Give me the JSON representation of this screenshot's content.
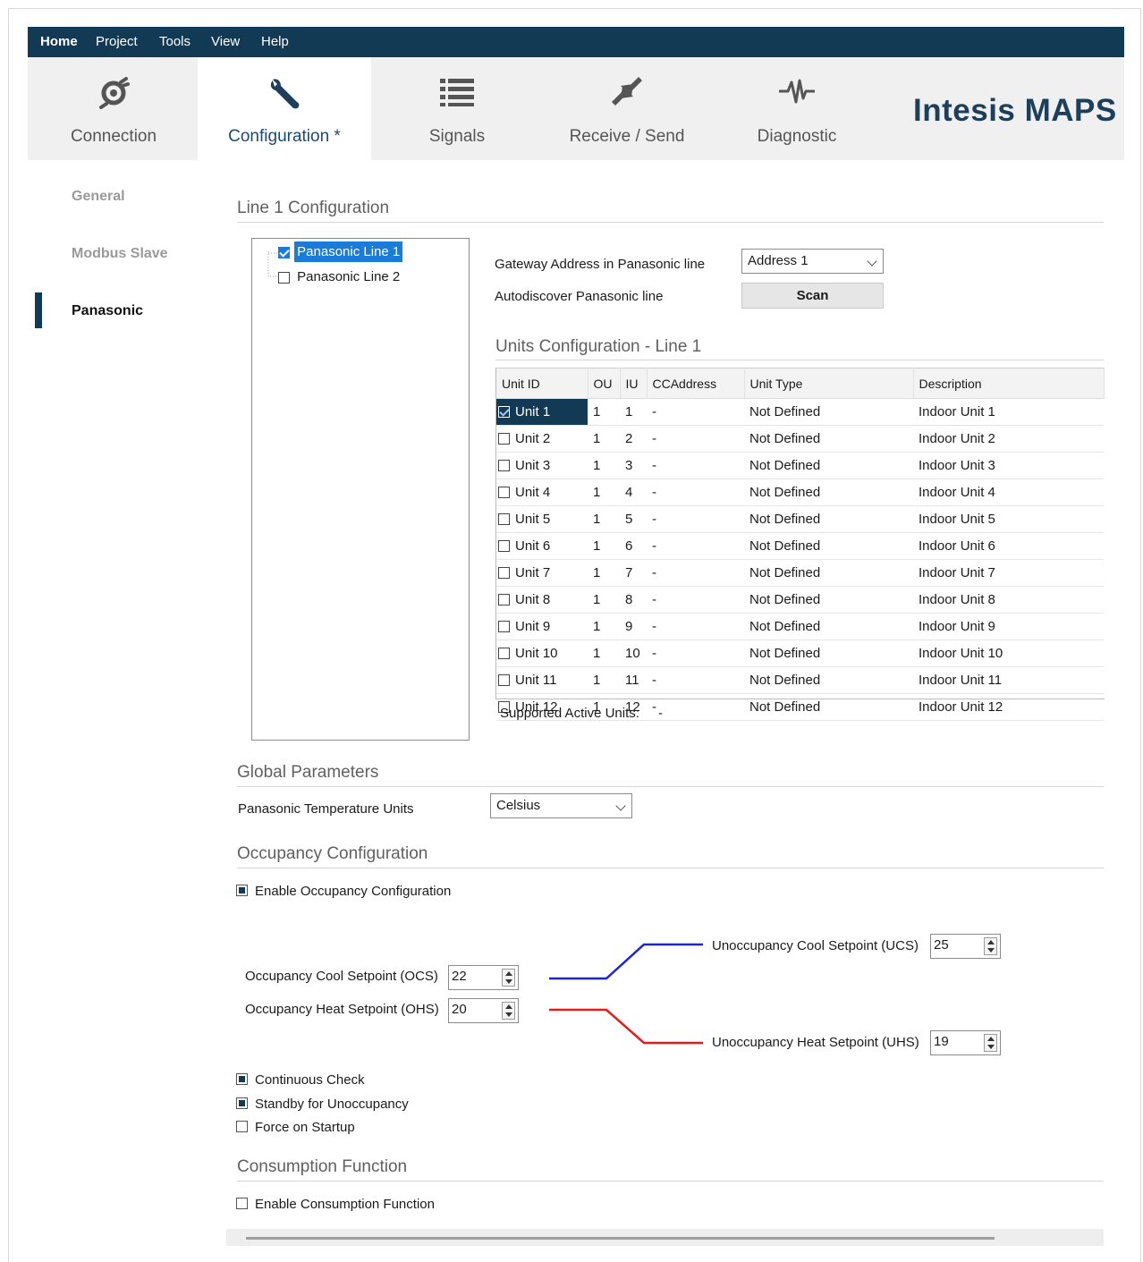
{
  "menu": {
    "home": "Home",
    "project": "Project",
    "tools": "Tools",
    "view": "View",
    "help": "Help"
  },
  "ribbon": {
    "connection": "Connection",
    "configuration": "Configuration *",
    "signals": "Signals",
    "receive_send": "Receive / Send",
    "diagnostic": "Diagnostic",
    "brand": "Intesis MAPS"
  },
  "sidebar": {
    "items": [
      {
        "label": "General"
      },
      {
        "label": "Modbus Slave"
      },
      {
        "label": "Panasonic"
      }
    ]
  },
  "line_config": {
    "title": "Line 1 Configuration",
    "tree": [
      {
        "label": "Panasonic Line 1",
        "checked": true
      },
      {
        "label": "Panasonic Line 2",
        "checked": false
      }
    ],
    "gateway_label": "Gateway Address in Panasonic line",
    "gateway_value": "Address 1",
    "autodiscover_label": "Autodiscover Panasonic line",
    "scan_label": "Scan"
  },
  "units": {
    "title": "Units Configuration - Line 1",
    "columns": [
      "Unit ID",
      "OU",
      "IU",
      "CCAddress",
      "Unit Type",
      "Description"
    ],
    "rows": [
      {
        "id": "Unit 1",
        "ou": "1",
        "iu": "1",
        "cc": "-",
        "type": "Not Defined",
        "desc": "Indoor Unit 1"
      },
      {
        "id": "Unit 2",
        "ou": "1",
        "iu": "2",
        "cc": "-",
        "type": "Not Defined",
        "desc": "Indoor Unit 2"
      },
      {
        "id": "Unit 3",
        "ou": "1",
        "iu": "3",
        "cc": "-",
        "type": "Not Defined",
        "desc": "Indoor Unit 3"
      },
      {
        "id": "Unit 4",
        "ou": "1",
        "iu": "4",
        "cc": "-",
        "type": "Not Defined",
        "desc": "Indoor Unit 4"
      },
      {
        "id": "Unit 5",
        "ou": "1",
        "iu": "5",
        "cc": "-",
        "type": "Not Defined",
        "desc": "Indoor Unit 5"
      },
      {
        "id": "Unit 6",
        "ou": "1",
        "iu": "6",
        "cc": "-",
        "type": "Not Defined",
        "desc": "Indoor Unit 6"
      },
      {
        "id": "Unit 7",
        "ou": "1",
        "iu": "7",
        "cc": "-",
        "type": "Not Defined",
        "desc": "Indoor Unit 7"
      },
      {
        "id": "Unit 8",
        "ou": "1",
        "iu": "8",
        "cc": "-",
        "type": "Not Defined",
        "desc": "Indoor Unit 8"
      },
      {
        "id": "Unit 9",
        "ou": "1",
        "iu": "9",
        "cc": "-",
        "type": "Not Defined",
        "desc": "Indoor Unit 9"
      },
      {
        "id": "Unit 10",
        "ou": "1",
        "iu": "10",
        "cc": "-",
        "type": "Not Defined",
        "desc": "Indoor Unit 10"
      },
      {
        "id": "Unit 11",
        "ou": "1",
        "iu": "11",
        "cc": "-",
        "type": "Not Defined",
        "desc": "Indoor Unit 11"
      },
      {
        "id": "Unit 12",
        "ou": "1",
        "iu": "12",
        "cc": "-",
        "type": "Not Defined",
        "desc": "Indoor Unit 12"
      }
    ],
    "supported_label": "Supported Active Units:",
    "supported_value": "-"
  },
  "global": {
    "title": "Global Parameters",
    "temp_label": "Panasonic Temperature Units",
    "temp_value": "Celsius"
  },
  "occupancy": {
    "title": "Occupancy Configuration",
    "enable_label": "Enable Occupancy Configuration",
    "ocs_label": "Occupancy Cool Setpoint (OCS)",
    "ocs_value": "22",
    "ohs_label": "Occupancy Heat Setpoint (OHS)",
    "ohs_value": "20",
    "ucs_label": "Unoccupancy Cool Setpoint (UCS)",
    "ucs_value": "25",
    "uhs_label": "Unoccupancy Heat Setpoint (UHS)",
    "uhs_value": "19",
    "continuous_label": "Continuous Check",
    "standby_label": "Standby for Unoccupancy",
    "force_label": "Force on Startup"
  },
  "consumption": {
    "title": "Consumption Function",
    "enable_label": "Enable Consumption Function"
  },
  "colors": {
    "navy": "#123a55",
    "cool_line": "#1a22e6",
    "heat_line": "#e61a1a",
    "selection": "#1a7cd8"
  }
}
